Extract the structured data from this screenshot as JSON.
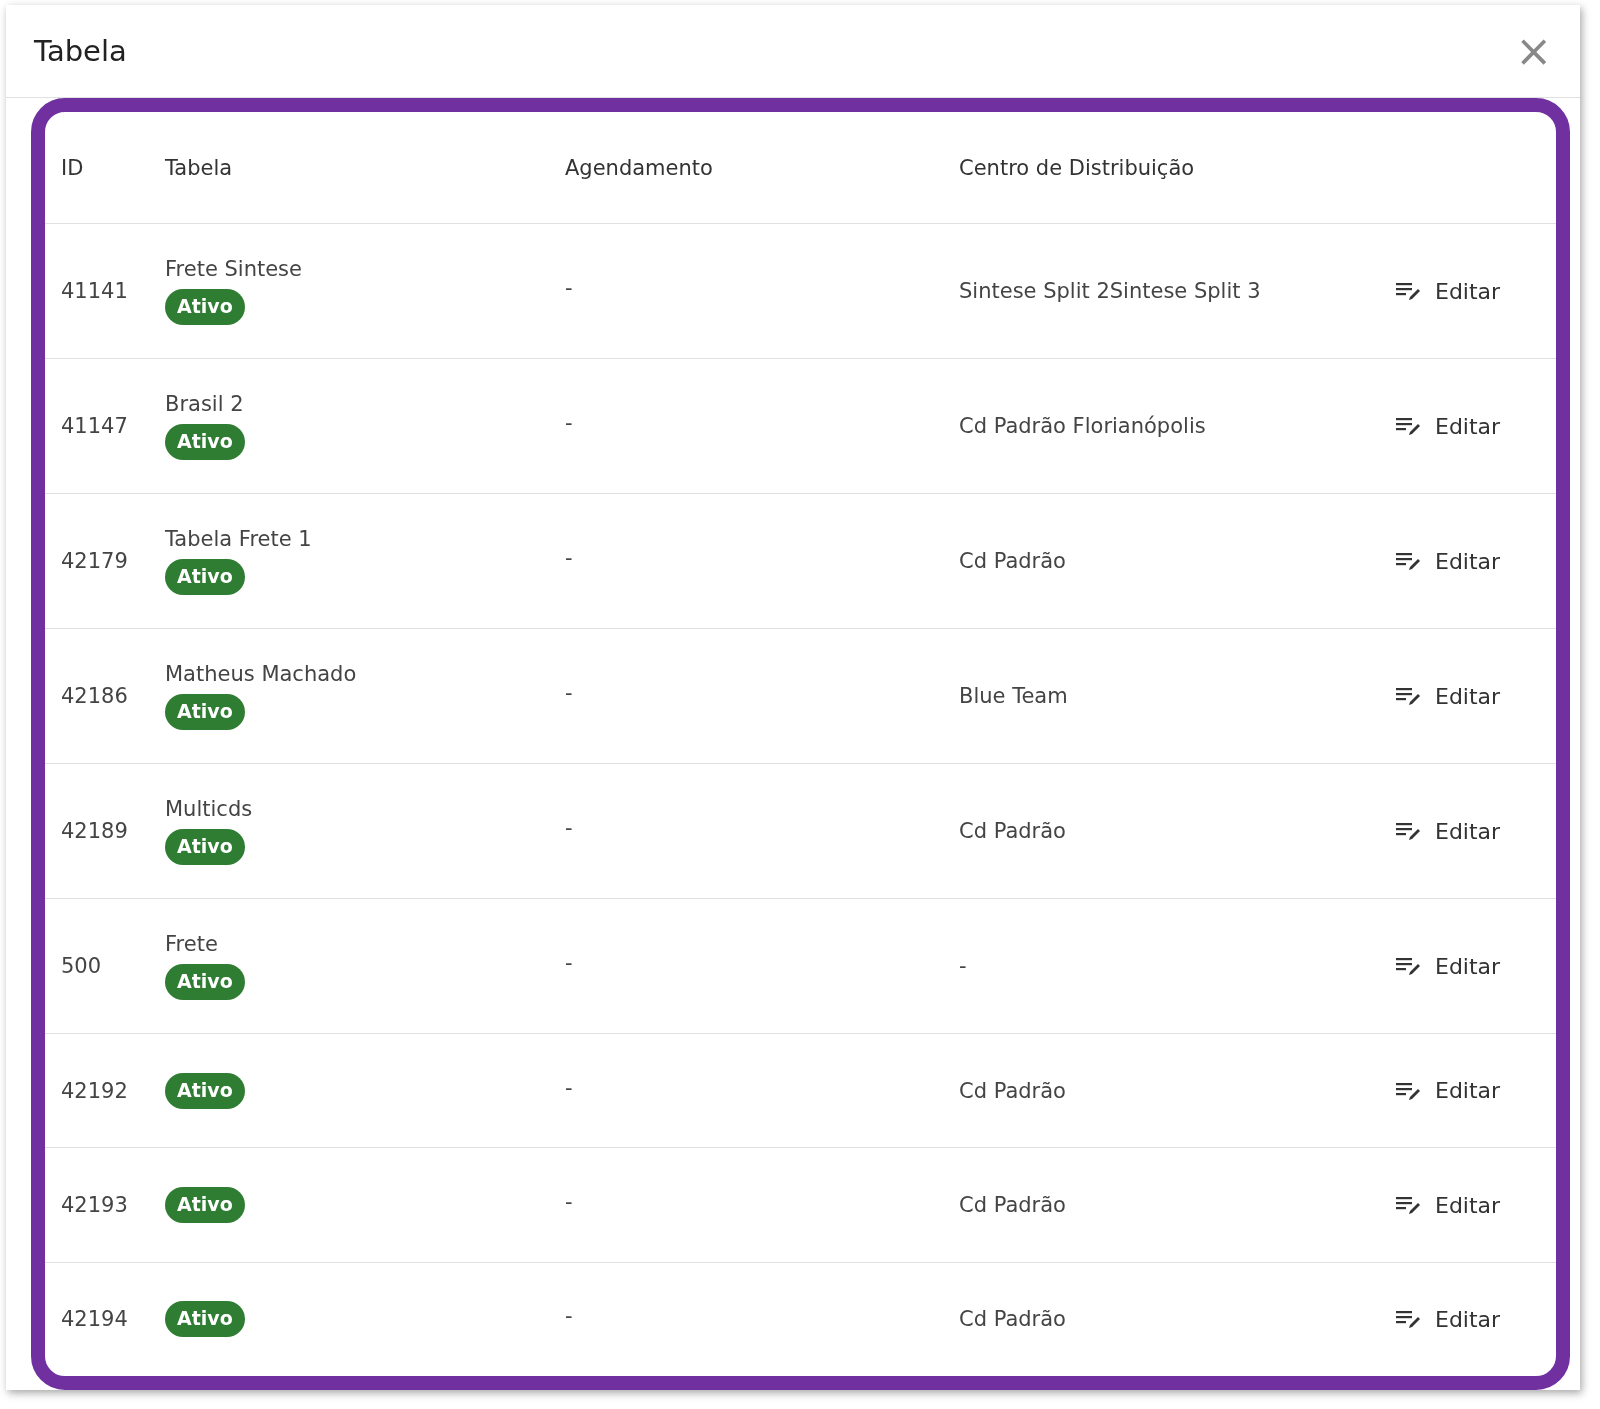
{
  "dialog": {
    "title": "Tabela",
    "close_icon": "×"
  },
  "table": {
    "columns": [
      "ID",
      "Tabela",
      "Agendamento",
      "Centro de Distribuição"
    ],
    "rows": [
      {
        "id": "41141",
        "name": "Frete Sintese",
        "status": {
          "label": "Ativo",
          "color": "#2e7d32"
        },
        "schedule": "-",
        "center": "Sintese Split 2Sintese Split 3",
        "action": "Editar"
      },
      {
        "id": "41147",
        "name": "Brasil 2",
        "status": {
          "label": "Ativo",
          "color": "#2e7d32"
        },
        "schedule": "-",
        "center": "Cd Padrão Florianópolis",
        "action": "Editar"
      },
      {
        "id": "42179",
        "name": "Tabela Frete 1",
        "status": {
          "label": "Ativo",
          "color": "#2e7d32"
        },
        "schedule": "-",
        "center": "Cd Padrão",
        "action": "Editar"
      },
      {
        "id": "42186",
        "name": "Matheus Machado",
        "status": {
          "label": "Ativo",
          "color": "#2e7d32"
        },
        "schedule": "-",
        "center": "Blue Team",
        "action": "Editar"
      },
      {
        "id": "42189",
        "name": "Multicds",
        "status": {
          "label": "Ativo",
          "color": "#2e7d32"
        },
        "schedule": "-",
        "center": "Cd Padrão",
        "action": "Editar"
      },
      {
        "id": "500",
        "name": "Frete",
        "status": {
          "label": "Ativo",
          "color": "#2e7d32"
        },
        "schedule": "-",
        "center": "-",
        "action": "Editar"
      },
      {
        "id": "42192",
        "status": {
          "label": "Ativo",
          "color": "#2e7d32"
        },
        "schedule": "-",
        "center": "Cd Padrão",
        "action": "Editar"
      },
      {
        "id": "42193",
        "status": {
          "label": "Ativo",
          "color": "#2e7d32"
        },
        "schedule": "-",
        "center": "Cd Padrão",
        "action": "Editar"
      },
      {
        "id": "42194",
        "status": {
          "label": "Ativo",
          "color": "#2e7d32"
        },
        "schedule": "-",
        "center": "Cd Padrão",
        "action": "Editar"
      }
    ]
  }
}
